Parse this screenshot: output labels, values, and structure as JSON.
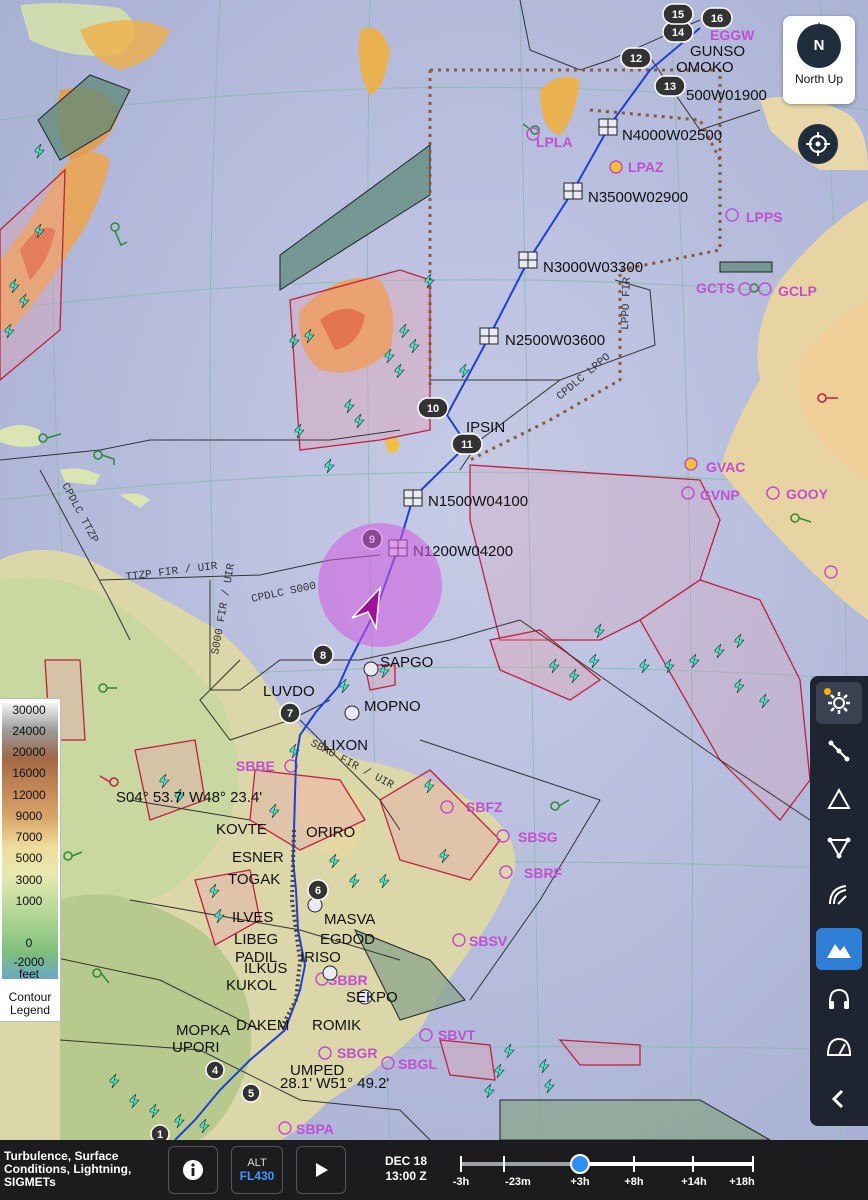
{
  "map": {
    "waypoints": [
      {
        "id": "N4000W02500",
        "label": "N4000W02500"
      },
      {
        "id": "N3500W02900",
        "label": "N3500W02900"
      },
      {
        "id": "N3000W03300",
        "label": "N3000W03300"
      },
      {
        "id": "N2500W03600",
        "label": "N2500W03600"
      },
      {
        "id": "IPSIN",
        "label": "IPSIN"
      },
      {
        "id": "N1500W04100",
        "label": "N1500W04100"
      },
      {
        "id": "N1200W04200",
        "label": "N1200W04200"
      },
      {
        "id": "SAPGO",
        "label": "SAPGO"
      },
      {
        "id": "LUVDO",
        "label": "LUVDO"
      },
      {
        "id": "MOPNO",
        "label": "MOPNO"
      },
      {
        "id": "LIXON",
        "label": "LIXON"
      },
      {
        "id": "KOVTE",
        "label": "KOVTE"
      },
      {
        "id": "ORIRO",
        "label": "ORIRO"
      },
      {
        "id": "ESNER",
        "label": "ESNER"
      },
      {
        "id": "TOGAK",
        "label": "TOGAK"
      },
      {
        "id": "ILVES",
        "label": "ILVES"
      },
      {
        "id": "LIBEG",
        "label": "LIBEG"
      },
      {
        "id": "PADIL",
        "label": "PADIL"
      },
      {
        "id": "ILKUS",
        "label": "ILKUS"
      },
      {
        "id": "KUKOL",
        "label": "KUKOL"
      },
      {
        "id": "DAKEM",
        "label": "DAKEM"
      },
      {
        "id": "MOPKA",
        "label": "MOPKA"
      },
      {
        "id": "UPORI",
        "label": "UPORI"
      },
      {
        "id": "MASVA",
        "label": "MASVA"
      },
      {
        "id": "EGDOD",
        "label": "EGDOD"
      },
      {
        "id": "IRISO",
        "label": "IRISO"
      },
      {
        "id": "SEKPO",
        "label": "SEKPO"
      },
      {
        "id": "ROMIK",
        "label": "ROMIK"
      },
      {
        "id": "UMPED",
        "label": "UMPED"
      },
      {
        "id": "OMOKO",
        "label": "OMOKO"
      },
      {
        "id": "GUNSO",
        "label": "GUNSO"
      },
      {
        "id": "N1900",
        "label": "500W01900"
      }
    ],
    "airports": [
      {
        "id": "LPLA",
        "label": "LPLA"
      },
      {
        "id": "LPAZ",
        "label": "LPAZ"
      },
      {
        "id": "LPPS",
        "label": "LPPS"
      },
      {
        "id": "GCTS",
        "label": "GCTS"
      },
      {
        "id": "GCLP",
        "label": "GCLP"
      },
      {
        "id": "GVAC",
        "label": "GVAC"
      },
      {
        "id": "GVNP",
        "label": "GVNP"
      },
      {
        "id": "GOOY",
        "label": "GOOY"
      },
      {
        "id": "SBBE",
        "label": "SBBE"
      },
      {
        "id": "SBFZ",
        "label": "SBFZ"
      },
      {
        "id": "SBSG",
        "label": "SBSG"
      },
      {
        "id": "SBRF",
        "label": "SBRF"
      },
      {
        "id": "SBSV",
        "label": "SBSV"
      },
      {
        "id": "SBBR",
        "label": "SBBR"
      },
      {
        "id": "SBVT",
        "label": "SBVT"
      },
      {
        "id": "SBGL",
        "label": "SBGL"
      },
      {
        "id": "SBGR",
        "label": "SBGR"
      },
      {
        "id": "SBPA",
        "label": "SBPA"
      },
      {
        "id": "EGGW",
        "label": "EGGW"
      }
    ],
    "fir_labels": {
      "ttzp": "TTZP FIR / UIR",
      "cpdlc_s000": "CPDLC S000",
      "s000_fir": "S000 FIR / UIR",
      "cpdlc_ttzp": "CPDLC TTZP",
      "cpdlc_lppo": "CPDLC LPPO",
      "lppo_fir": "LPPO FIR",
      "sbao_fir": "SBAO FIR / UIR"
    },
    "coords": {
      "c1": "S04° 53.7' W48° 23.4'",
      "c2": "28.1' W51° 49.2'"
    },
    "leg_numbers": [
      "1",
      "4",
      "5",
      "6",
      "7",
      "8",
      "9",
      "10",
      "11",
      "12",
      "13",
      "14",
      "15",
      "16"
    ]
  },
  "controls": {
    "north_up_label": "North Up",
    "north_letter": "N"
  },
  "legend": {
    "ticks": [
      "30000",
      "24000",
      "20000",
      "16000",
      "12000",
      "9000",
      "7000",
      "5000",
      "3000",
      "1000",
      "0",
      "-2000"
    ],
    "unit": "feet",
    "title_line1": "Contour",
    "title_line2": "Legend"
  },
  "bottom_bar": {
    "layers_text": "Turbulence, Surface Conditions, Lightning, SIGMETs",
    "alt_label": "ALT",
    "alt_value": "FL430",
    "date": "DEC 18",
    "time": "13:00 Z",
    "timeline_labels": [
      "-3h",
      "-23m",
      "+3h",
      "+8h",
      "+14h",
      "+18h"
    ]
  },
  "colors": {
    "route": "#1f3fd6",
    "airport": "#c24fd1",
    "active_tool": "#2f7fd6",
    "aircraft": "#a0109a"
  }
}
